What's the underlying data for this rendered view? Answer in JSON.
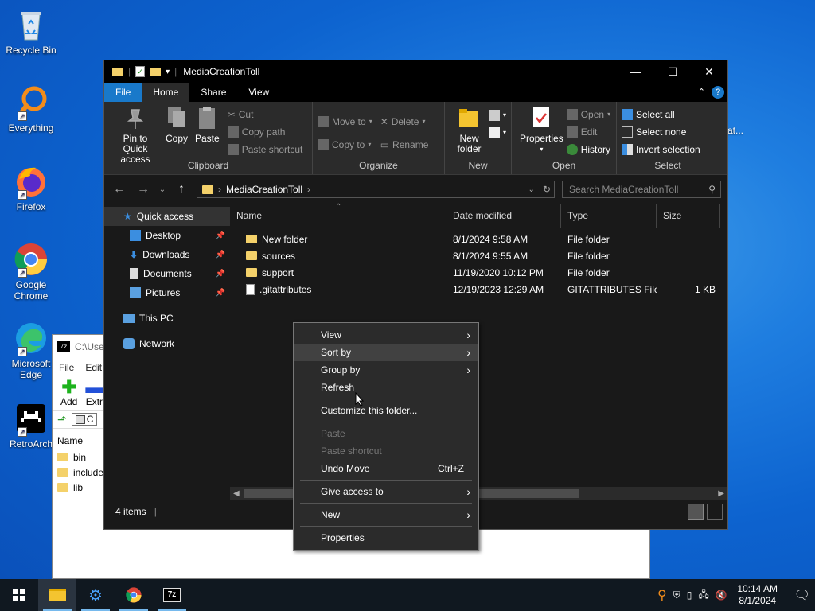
{
  "desktop": {
    "icons": [
      {
        "label": "Recycle Bin",
        "icon": "recycle-bin-icon"
      },
      {
        "label": "Everything",
        "icon": "everything-icon"
      },
      {
        "label": "Firefox",
        "icon": "firefox-icon"
      },
      {
        "label": "Google Chrome",
        "icon": "chrome-icon"
      },
      {
        "label": "Microsoft Edge",
        "icon": "edge-icon"
      },
      {
        "label": "RetroArch",
        "icon": "retroarch-icon"
      }
    ],
    "partial_label": "at..."
  },
  "sevenzip": {
    "title": "C:\\Use",
    "menu": [
      "File",
      "Edit"
    ],
    "toolbar": [
      "Add",
      "Extr"
    ],
    "path": "C",
    "column": "Name",
    "rows": [
      "bin",
      "include",
      "lib"
    ]
  },
  "explorer": {
    "title": "MediaCreationToll",
    "tabs": [
      "File",
      "Home",
      "Share",
      "View"
    ],
    "ribbon": {
      "clipboard": {
        "label": "Clipboard",
        "pin": "Pin to Quick access",
        "copy": "Copy",
        "paste": "Paste",
        "cut": "Cut",
        "copy_path": "Copy path",
        "paste_shortcut": "Paste shortcut"
      },
      "organize": {
        "label": "Organize",
        "move_to": "Move to",
        "copy_to": "Copy to",
        "delete": "Delete",
        "rename": "Rename"
      },
      "new": {
        "label": "New",
        "new_folder": "New folder"
      },
      "open": {
        "label": "Open",
        "properties": "Properties",
        "open": "Open",
        "edit": "Edit",
        "history": "History"
      },
      "select": {
        "label": "Select",
        "select_all": "Select all",
        "select_none": "Select none",
        "invert": "Invert selection"
      }
    },
    "address": {
      "path": "MediaCreationToll",
      "search_placeholder": "Search MediaCreationToll"
    },
    "nav": [
      {
        "label": "Quick access",
        "icon": "star-icon",
        "pinned": false,
        "indent": 0
      },
      {
        "label": "Desktop",
        "icon": "desktop-icon",
        "pinned": true,
        "indent": 1
      },
      {
        "label": "Downloads",
        "icon": "download-icon",
        "pinned": true,
        "indent": 1
      },
      {
        "label": "Documents",
        "icon": "document-icon",
        "pinned": true,
        "indent": 1
      },
      {
        "label": "Pictures",
        "icon": "picture-icon",
        "pinned": true,
        "indent": 1
      },
      {
        "label": "This PC",
        "icon": "pc-icon",
        "pinned": false,
        "indent": 0
      },
      {
        "label": "Network",
        "icon": "network-icon",
        "pinned": false,
        "indent": 0
      }
    ],
    "columns": [
      "Name",
      "Date modified",
      "Type",
      "Size"
    ],
    "files": [
      {
        "name": "New folder",
        "date": "8/1/2024 9:58 AM",
        "type": "File folder",
        "size": "",
        "kind": "folder"
      },
      {
        "name": "sources",
        "date": "8/1/2024 9:55 AM",
        "type": "File folder",
        "size": "",
        "kind": "folder"
      },
      {
        "name": "support",
        "date": "11/19/2020 10:12 PM",
        "type": "File folder",
        "size": "",
        "kind": "folder"
      },
      {
        "name": ".gitattributes",
        "date": "12/19/2023 12:29 AM",
        "type": "GITATTRIBUTES File",
        "size": "1 KB",
        "kind": "file"
      }
    ],
    "status": "4 items"
  },
  "context_menu": {
    "items": [
      {
        "label": "View",
        "sub": true
      },
      {
        "label": "Sort by",
        "sub": true,
        "hl": true
      },
      {
        "label": "Group by",
        "sub": true
      },
      {
        "label": "Refresh"
      },
      {
        "sep": true
      },
      {
        "label": "Customize this folder..."
      },
      {
        "sep": true
      },
      {
        "label": "Paste",
        "disabled": true
      },
      {
        "label": "Paste shortcut",
        "disabled": true
      },
      {
        "label": "Undo Move",
        "accel": "Ctrl+Z"
      },
      {
        "sep": true
      },
      {
        "label": "Give access to",
        "sub": true
      },
      {
        "sep": true
      },
      {
        "label": "New",
        "sub": true
      },
      {
        "sep": true
      },
      {
        "label": "Properties"
      }
    ]
  },
  "taskbar": {
    "apps": [
      "file-explorer-icon",
      "app-icon",
      "chrome-icon",
      "7zip-icon"
    ],
    "time": "10:14 AM",
    "date": "8/1/2024"
  }
}
